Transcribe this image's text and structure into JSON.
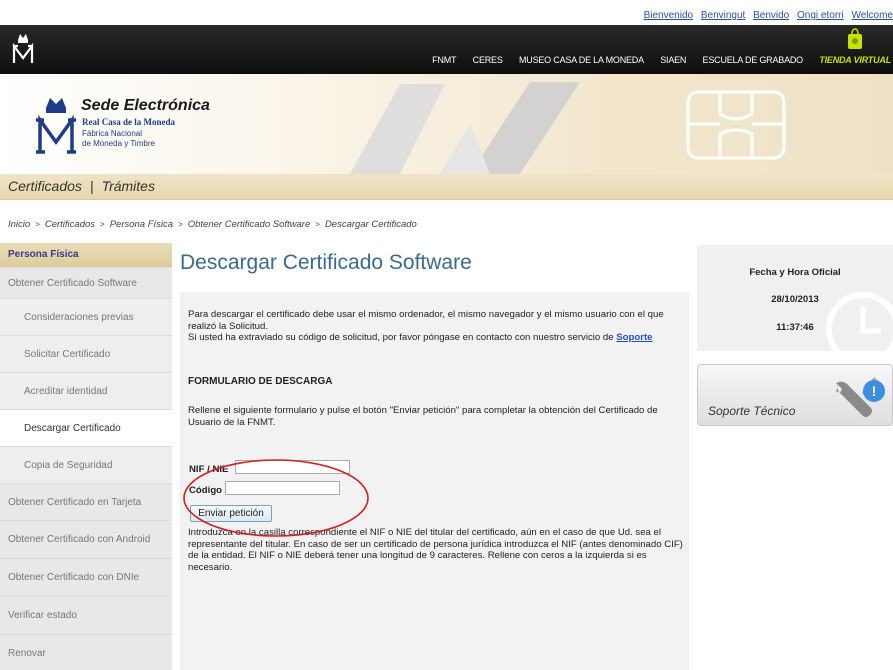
{
  "languages": [
    "Bienvenido",
    "Benvingut",
    "Benvido",
    "Ongi etorri",
    "Welcome"
  ],
  "top_nav": {
    "items": [
      "FNMT",
      "CERES",
      "MUSEO CASA DE LA MONEDA",
      "SIAEN",
      "ESCUELA DE GRABADO"
    ],
    "store": "TIENDA VIRTUAL"
  },
  "banner": {
    "title": "Sede Electrónica",
    "org": "Real Casa de la Moneda",
    "sub1": "Fábrica Nacional",
    "sub2": "de Moneda y Timbre"
  },
  "section_nav": {
    "items": [
      "Certificados",
      "Trámites"
    ],
    "separator": "|"
  },
  "breadcrumb": [
    "Inicio",
    "Certificados",
    "Persona Física",
    "Obtener Certificado Software",
    "Descargar Certificado"
  ],
  "sidebar": {
    "header": "Persona Física",
    "items": [
      {
        "label": "Obtener Certificado Software",
        "level": "top"
      },
      {
        "label": "Consideraciones previas",
        "level": "sub"
      },
      {
        "label": "Solicitar Certificado",
        "level": "sub"
      },
      {
        "label": "Acreditar identidad",
        "level": "sub"
      },
      {
        "label": "Descargar Certificado",
        "level": "sub",
        "active": true
      },
      {
        "label": "Copia de Seguridad",
        "level": "sub"
      },
      {
        "label": "Obtener Certificado en Tarjeta",
        "level": "top"
      },
      {
        "label": "Obtener Certificado con Android",
        "level": "top"
      },
      {
        "label": "Obtener Certificado con DNIe",
        "level": "top"
      },
      {
        "label": "Verificar estado",
        "level": "top"
      },
      {
        "label": "Renovar",
        "level": "top"
      }
    ]
  },
  "main": {
    "title": "Descargar Certificado Software",
    "intro_1": "Para descargar el certificado debe usar el mismo ordenador, el mismo navegador y el mismo usuario con el que realizó la Solicitud.",
    "intro_2": "Si usted ha extraviado su código de solicitud, por favor póngase en contacto con nuestro servicio de ",
    "support_link": "Soporte",
    "form_heading": "FORMULARIO DE DESCARGA",
    "form_instructions": "Rellene el siguiente formulario y pulse el botón \"Enviar petición\" para completar la obtención del Certificado de Usuario de la FNMT.",
    "nif_label": "NIF / NIE",
    "nif_value": "",
    "code_label": "Código",
    "code_value": "",
    "submit_label": "Enviar petición",
    "help_text": "Introduzca en la casilla correspondiente el NIF o NIE del titular del certificado, aún en el caso de que Ud. sea el representante del titular. En caso de ser un certificado de persona jurídica introduzca el NIF (antes denominado CIF) de la entidad. El NIF o NIE deberá tener una longitud de 9 caracteres. Rellene con ceros a la izquierda si es necesario."
  },
  "right": {
    "date_title": "Fecha y Hora Oficial",
    "date": "28/10/2013",
    "time": "11:37:46",
    "support_label": "Soporte Técnico"
  },
  "colors": {
    "annotation_ellipse": "#d42020",
    "title_blue": "#3a6b8e",
    "link_blue": "#1f4fcf",
    "store_green": "#c8e000"
  },
  "icons": [
    "crown-m-logo",
    "shopping-bag-icon",
    "chip-card-icon",
    "clock-icon",
    "wrench-support-icon"
  ]
}
